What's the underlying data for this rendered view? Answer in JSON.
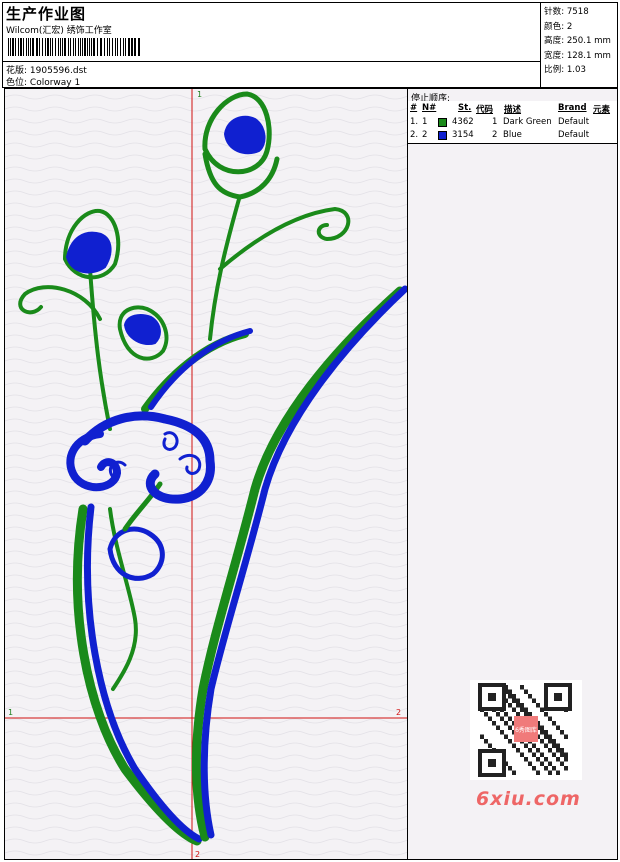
{
  "header": {
    "title": "生产作业图",
    "company": "Wilcom(汇宏) 绣饰工作室",
    "design_label": "花版:",
    "design_value": "1905596.dst",
    "colorway_label": "色位:",
    "colorway_value": "Colorway 1"
  },
  "stats": {
    "stitches": "针数: 7518",
    "colors": "颜色: 2",
    "height": "高度: 250.1 mm",
    "width": "宽度: 128.1 mm",
    "scale": "比例: 1.03"
  },
  "sequence": {
    "title": "停止顺序:",
    "headers": [
      "#",
      "N#",
      "St.",
      "代码",
      "描述",
      "Brand",
      "元素"
    ],
    "rows": [
      {
        "num": "1.",
        "n": "1",
        "color": "#1a8a1a",
        "st": "4362",
        "code": "1",
        "desc": "Dark Green",
        "brand": "Default"
      },
      {
        "num": "2.",
        "n": "2",
        "color": "#1020d0",
        "st": "3154",
        "code": "2",
        "desc": "Blue",
        "brand": "Default"
      }
    ]
  },
  "markers": {
    "m1_top": "1",
    "m1_left": "1",
    "m2_right": "2",
    "m2_bottom": "2"
  },
  "watermark": {
    "text": "6xiu.com",
    "badge": "6秀图库"
  }
}
